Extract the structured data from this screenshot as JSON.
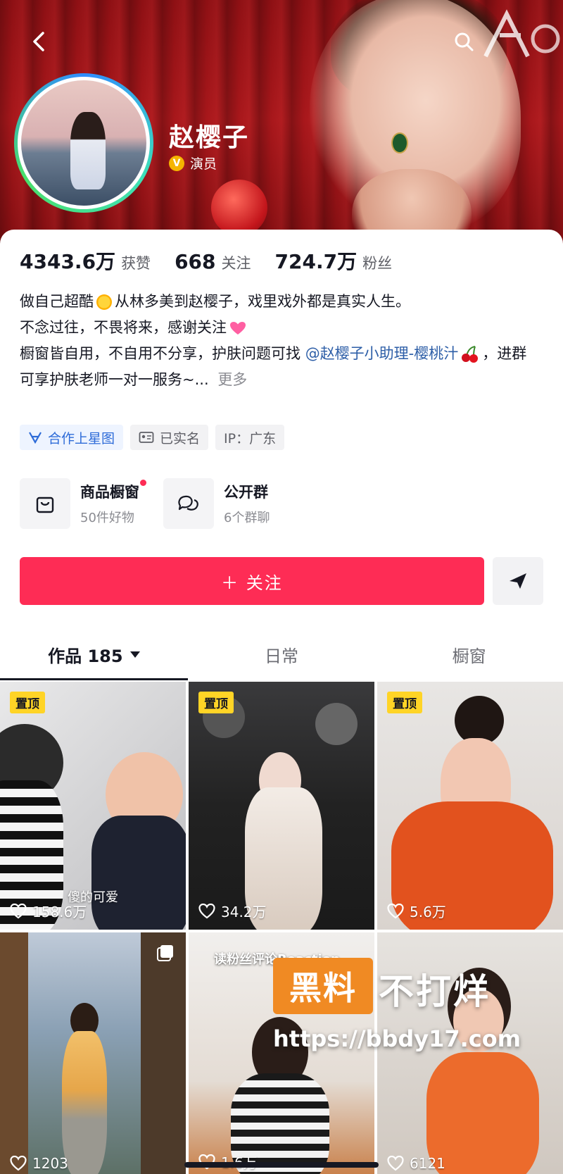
{
  "profile": {
    "name": "赵樱子",
    "verify_label": "演员",
    "verify_badge": "V"
  },
  "stats": [
    {
      "value": "4343.6万",
      "label": "获赞"
    },
    {
      "value": "668",
      "label": "关注"
    },
    {
      "value": "724.7万",
      "label": "粉丝"
    }
  ],
  "bio": {
    "line1_a": "做自己超酷",
    "line1_b": "从林多美到赵樱子，戏里戏外都是真实人生。",
    "line2": "不念过往，不畏将来，感谢关注",
    "line3_a": "橱窗皆自用，不自用不分享，护肤问题可找",
    "mention": "@赵樱子小助理-樱桃汁",
    "line4_b": "，进群可享护肤老师一对一服务~...",
    "more": "更多"
  },
  "tags": [
    {
      "label": "合作上星图",
      "icon": "star-map-icon"
    },
    {
      "label": "已实名",
      "icon": "id-card-icon"
    },
    {
      "label": "IP：广东"
    }
  ],
  "shop": [
    {
      "title": "商品橱窗",
      "sub": "50件好物",
      "icon": "shopping-bag-icon"
    },
    {
      "title": "公开群",
      "sub": "6个群聊",
      "icon": "chat-group-icon"
    }
  ],
  "actions": {
    "follow_label": "＋ 关注"
  },
  "tabs": [
    {
      "label": "作品 185"
    },
    {
      "label": "日常"
    },
    {
      "label": "橱窗"
    }
  ],
  "videos": [
    {
      "pinned": "置顶",
      "likes": "158.6万",
      "caption": "傻的可爱"
    },
    {
      "pinned": "置顶",
      "likes": "34.2万"
    },
    {
      "pinned": "置顶",
      "likes": "5.6万"
    },
    {
      "likes": "1203"
    },
    {
      "likes": "1.6万",
      "caption": "读粉丝评论Reaction"
    },
    {
      "likes": "6121"
    }
  ],
  "watermark": {
    "box": "黑料",
    "title": "不打烊",
    "url": "https://bbdy17.com"
  },
  "colors": {
    "accent": "#fe2c55",
    "banner": "#a8171b",
    "pin": "#ffd426",
    "mention": "#2d5ea7"
  }
}
